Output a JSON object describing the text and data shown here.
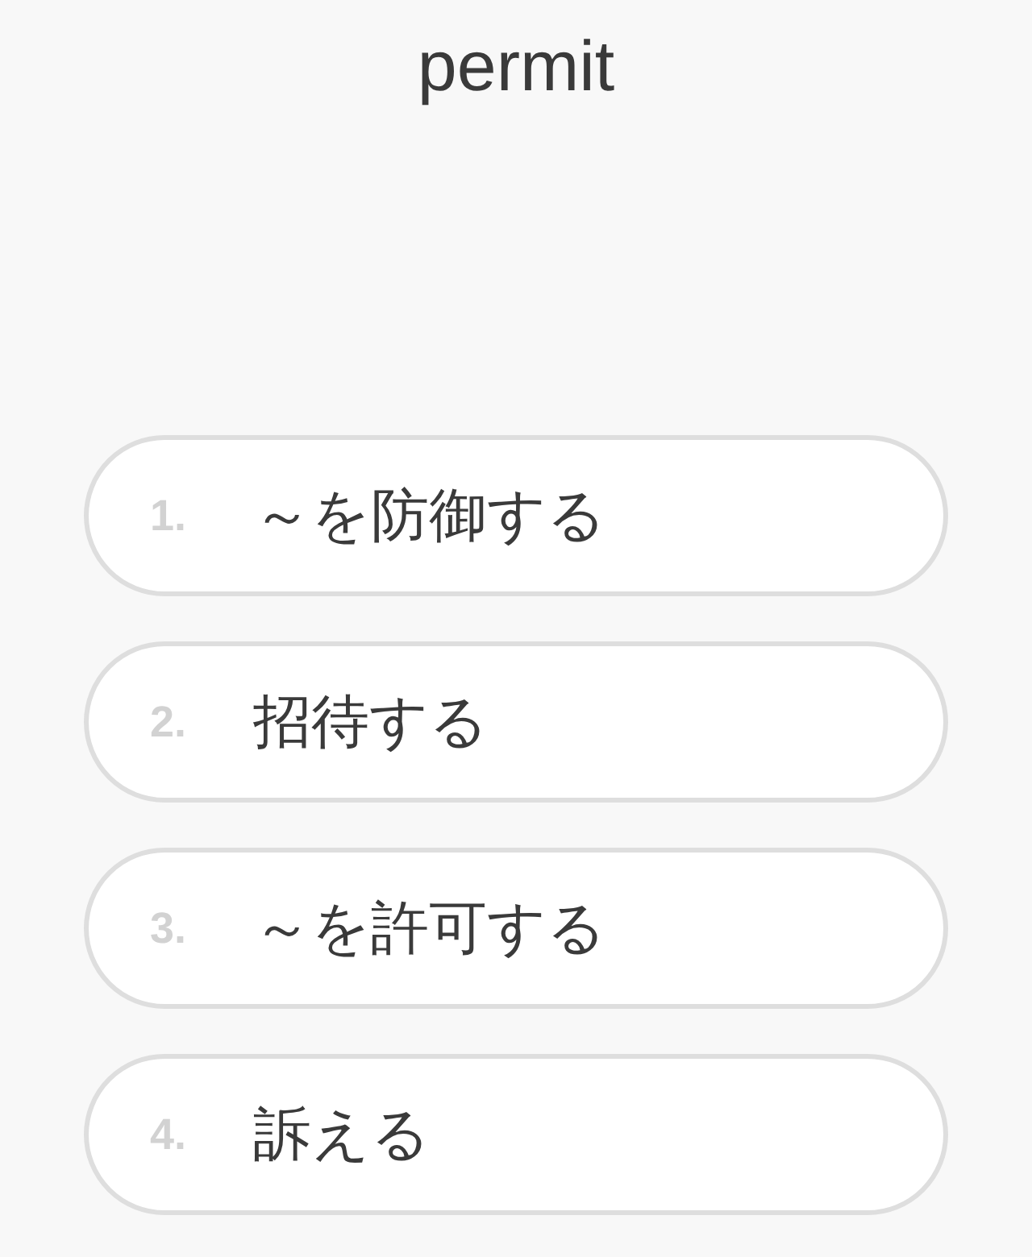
{
  "word": "permit",
  "options": [
    {
      "number": "1.",
      "text": "～を防御する"
    },
    {
      "number": "2.",
      "text": "招待する"
    },
    {
      "number": "3.",
      "text": "～を許可する"
    },
    {
      "number": "4.",
      "text": "訴える"
    }
  ]
}
